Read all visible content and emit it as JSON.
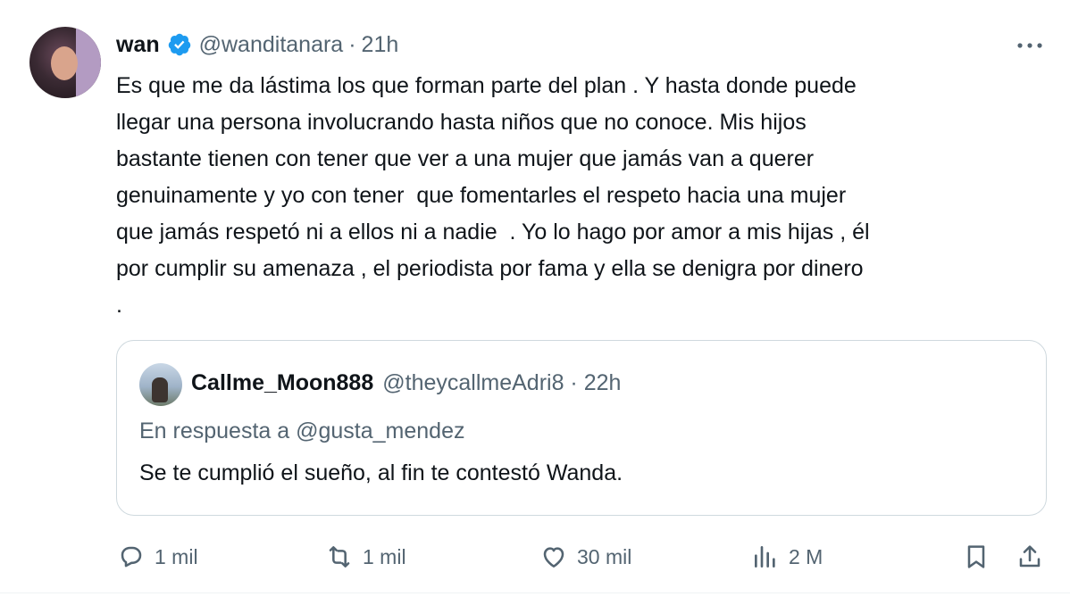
{
  "tweet": {
    "name": "wan",
    "handle": "@wanditanara",
    "separator": "·",
    "time": "21h",
    "lines": [
      "Es que me da lástima los que forman parte del plan . Y hasta donde puede",
      "llegar una persona involucrando hasta niños que no conoce. Mis hijos",
      "bastante tienen con tener que ver a una mujer que jamás van a querer",
      "genuinamente y yo con tener  que fomentarles el respeto hacia una mujer",
      "que jamás respetó ni a ellos ni a nadie  . Yo lo hago por amor a mis hijas , él",
      "por cumplir su amenaza , el periodista por fama y ella se denigra por dinero",
      "."
    ]
  },
  "quote": {
    "name": "Callme_Moon888",
    "handle": "@theycallmeAdri8 · 22h",
    "reply_to": "En respuesta a @gusta_mendez",
    "text": "Se te cumplió el sueño, al fin te contestó Wanda."
  },
  "actions": {
    "replies": "1 mil",
    "reposts": "1 mil",
    "likes": "30 mil",
    "views": "2 M"
  },
  "icons": {
    "verified": "verified-badge-icon",
    "more": "more-icon",
    "reply": "reply-icon",
    "repost": "repost-icon",
    "like": "heart-icon",
    "views": "views-icon",
    "bookmark": "bookmark-icon",
    "share": "share-icon"
  },
  "colors": {
    "verified": "#1d9bf0",
    "secondary_text": "#536471",
    "border": "#cfd9de"
  }
}
